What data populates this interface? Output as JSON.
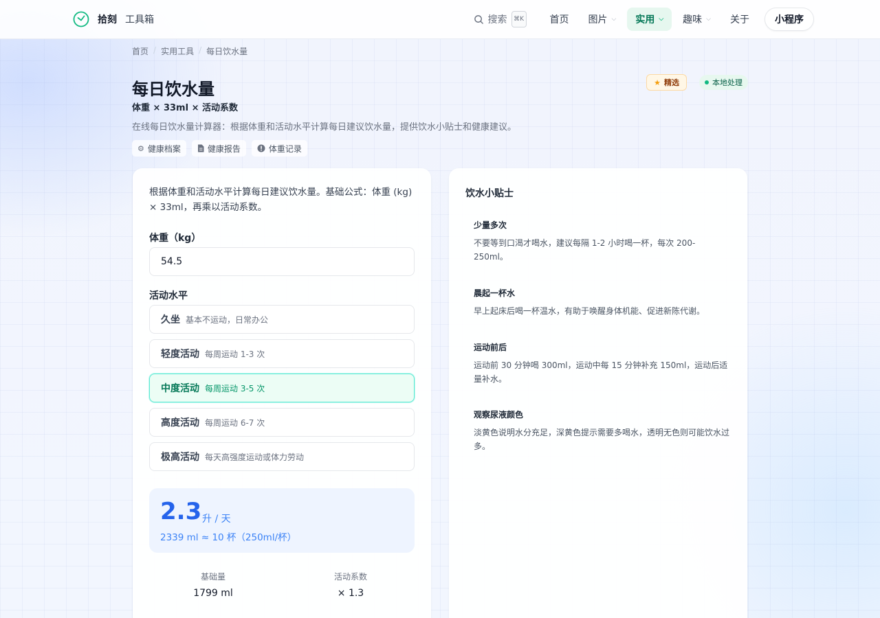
{
  "header": {
    "brand_name": "拾刻",
    "brand_sub": "工具箱",
    "search_label": "搜索",
    "search_kbd": "⌘K",
    "nav": [
      {
        "label": "首页"
      },
      {
        "label": "图片"
      },
      {
        "label": "实用"
      },
      {
        "label": "趣味"
      },
      {
        "label": "关于"
      }
    ],
    "mini_program": "小程序",
    "accent": "#10b981"
  },
  "breadcrumb": [
    "首页",
    "实用工具",
    "每日饮水量"
  ],
  "page": {
    "title": "每日饮水量",
    "formula": "体重 × 33ml × 活动系数",
    "description": "在线每日饮水量计算器：根据体重和活动水平计算每日建议饮水量，提供饮水小贴士和健康建议。",
    "badge_featured": "精选",
    "badge_local": "本地处理",
    "links": [
      {
        "label": "健康档案",
        "icon": "gear-icon"
      },
      {
        "label": "健康报告",
        "icon": "document-icon"
      },
      {
        "label": "体重记录",
        "icon": "alert-circle-icon"
      }
    ]
  },
  "calculator": {
    "intro": "根据体重和活动水平计算每日建议饮水量。基础公式：体重 (kg) × 33ml，再乘以活动系数。",
    "weight_label": "体重（kg）",
    "weight_value": "54.5",
    "activity_label": "活动水平",
    "activities": [
      {
        "name": "久坐",
        "hint": "基本不运动，日常办公",
        "selected": false
      },
      {
        "name": "轻度活动",
        "hint": "每周运动 1-3 次",
        "selected": false
      },
      {
        "name": "中度活动",
        "hint": "每周运动 3-5 次",
        "selected": true
      },
      {
        "name": "高度活动",
        "hint": "每周运动 6-7 次",
        "selected": false
      },
      {
        "name": "极高活动",
        "hint": "每天高强度运动或体力劳动",
        "selected": false
      }
    ],
    "result_value": "2.3",
    "result_unit": "升 / 天",
    "result_detail": "2339 ml ≈ 10 杯（250ml/杯）",
    "base_label": "基础量",
    "base_value": "1799 ml",
    "factor_label": "活动系数",
    "factor_value": "× 1.3"
  },
  "tips": {
    "title": "饮水小贴士",
    "items": [
      {
        "heading": "少量多次",
        "body": "不要等到口渴才喝水，建议每隔 1-2 小时喝一杯，每次 200-250ml。"
      },
      {
        "heading": "晨起一杯水",
        "body": "早上起床后喝一杯温水，有助于唤醒身体机能、促进新陈代谢。"
      },
      {
        "heading": "运动前后",
        "body": "运动前 30 分钟喝 300ml，运动中每 15 分钟补充 150ml，运动后适量补水。"
      },
      {
        "heading": "观察尿液颜色",
        "body": "淡黄色说明水分充足，深黄色提示需要多喝水，透明无色则可能饮水过多。"
      }
    ]
  }
}
